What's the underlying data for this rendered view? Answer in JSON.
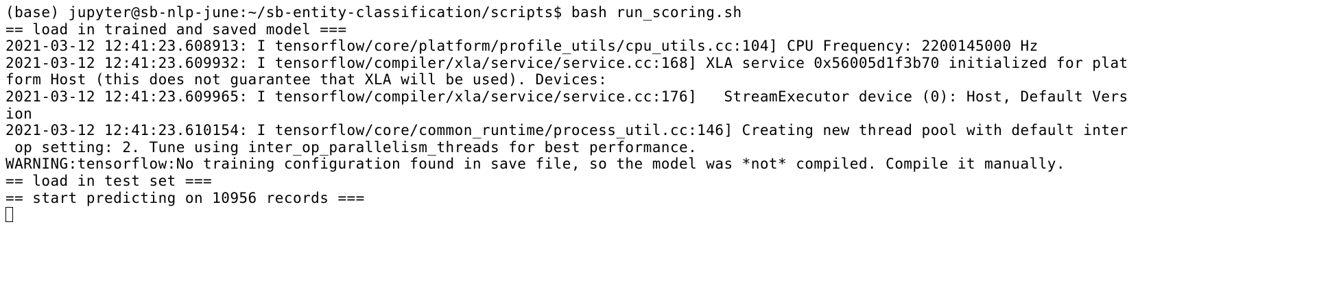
{
  "terminal": {
    "lines": [
      "(base) jupyter@sb-nlp-june:~/sb-entity-classification/scripts$ bash run_scoring.sh",
      "== load in trained and saved model ===",
      "2021-03-12 12:41:23.608913: I tensorflow/core/platform/profile_utils/cpu_utils.cc:104] CPU Frequency: 2200145000 Hz",
      "2021-03-12 12:41:23.609932: I tensorflow/compiler/xla/service/service.cc:168] XLA service 0x56005d1f3b70 initialized for plat",
      "form Host (this does not guarantee that XLA will be used). Devices:",
      "2021-03-12 12:41:23.609965: I tensorflow/compiler/xla/service/service.cc:176]   StreamExecutor device (0): Host, Default Vers",
      "ion",
      "2021-03-12 12:41:23.610154: I tensorflow/core/common_runtime/process_util.cc:146] Creating new thread pool with default inter",
      " op setting: 2. Tune using inter_op_parallelism_threads for best performance.",
      "WARNING:tensorflow:No training configuration found in save file, so the model was *not* compiled. Compile it manually.",
      "== load in test set ===",
      "== start predicting on 10956 records ==="
    ]
  }
}
